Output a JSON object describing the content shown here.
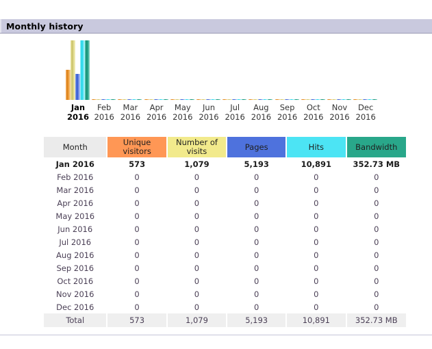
{
  "section": {
    "title": "Monthly history"
  },
  "chart_data": {
    "type": "bar",
    "title": "Monthly history",
    "xlabel": "",
    "ylabel": "",
    "grid": false,
    "legend": "none",
    "categories": [
      "Jan 2016",
      "Feb 2016",
      "Mar 2016",
      "Apr 2016",
      "May 2016",
      "Jun 2016",
      "Jul 2016",
      "Aug 2016",
      "Sep 2016",
      "Oct 2016",
      "Nov 2016",
      "Dec 2016"
    ],
    "category_lines": [
      {
        "mon": "Jan",
        "yr": "2016"
      },
      {
        "mon": "Feb",
        "yr": "2016"
      },
      {
        "mon": "Mar",
        "yr": "2016"
      },
      {
        "mon": "Apr",
        "yr": "2016"
      },
      {
        "mon": "May",
        "yr": "2016"
      },
      {
        "mon": "Jun",
        "yr": "2016"
      },
      {
        "mon": "Jul",
        "yr": "2016"
      },
      {
        "mon": "Aug",
        "yr": "2016"
      },
      {
        "mon": "Sep",
        "yr": "2016"
      },
      {
        "mon": "Oct",
        "yr": "2016"
      },
      {
        "mon": "Nov",
        "yr": "2016"
      },
      {
        "mon": "Dec",
        "yr": "2016"
      }
    ],
    "highlighted_category": "Jan 2016",
    "series": [
      {
        "name": "Unique visitors",
        "key": "unique",
        "color": "#ff9755",
        "values": [
          573,
          0,
          0,
          0,
          0,
          0,
          0,
          0,
          0,
          0,
          0,
          0
        ]
      },
      {
        "name": "Number of visits",
        "key": "visits",
        "color": "#f2ea8c",
        "values": [
          1079,
          0,
          0,
          0,
          0,
          0,
          0,
          0,
          0,
          0,
          0,
          0
        ]
      },
      {
        "name": "Pages",
        "key": "pages",
        "color": "#4e72dd",
        "values": [
          5193,
          0,
          0,
          0,
          0,
          0,
          0,
          0,
          0,
          0,
          0,
          0
        ]
      },
      {
        "name": "Hits",
        "key": "hits",
        "color": "#4ce4f4",
        "values": [
          10891,
          0,
          0,
          0,
          0,
          0,
          0,
          0,
          0,
          0,
          0,
          0
        ]
      },
      {
        "name": "Bandwidth",
        "key": "bw",
        "color": "#29a78a",
        "values": [
          352.73,
          0,
          0,
          0,
          0,
          0,
          0,
          0,
          0,
          0,
          0,
          0
        ],
        "unit": "MB"
      }
    ],
    "bar_pixel_heights": {
      "unique": [
        44,
        1,
        1,
        1,
        1,
        1,
        1,
        1,
        1,
        1,
        1,
        1
      ],
      "visits": [
        87,
        1,
        1,
        1,
        1,
        1,
        1,
        1,
        1,
        1,
        1,
        1
      ],
      "pages": [
        38,
        1,
        1,
        1,
        1,
        1,
        1,
        1,
        1,
        1,
        1,
        1
      ],
      "hits": [
        87,
        1,
        1,
        1,
        1,
        1,
        1,
        1,
        1,
        1,
        1,
        1
      ],
      "bw": [
        87,
        1,
        1,
        1,
        1,
        1,
        1,
        1,
        1,
        1,
        1,
        1
      ]
    }
  },
  "table": {
    "headers": [
      {
        "label": "Month",
        "key": "month",
        "color": "#ebebeb"
      },
      {
        "label": "Unique visitors",
        "key": "unique",
        "color": "#ff9755"
      },
      {
        "label": "Number of visits",
        "key": "visits",
        "color": "#f2ea8c"
      },
      {
        "label": "Pages",
        "key": "pages",
        "color": "#4e72dd"
      },
      {
        "label": "Hits",
        "key": "hits",
        "color": "#4ce4f4"
      },
      {
        "label": "Bandwidth",
        "key": "bw",
        "color": "#29a78a"
      }
    ],
    "header_lines": {
      "month": [
        "Month"
      ],
      "unique": [
        "Unique",
        "visitors"
      ],
      "visits": [
        "Number of",
        "visits"
      ],
      "pages": [
        "Pages"
      ],
      "hits": [
        "Hits"
      ],
      "bw": [
        "Bandwidth"
      ]
    },
    "rows": [
      {
        "month": "Jan 2016",
        "unique": "573",
        "visits": "1,079",
        "pages": "5,193",
        "hits": "10,891",
        "bw": "352.73 MB",
        "current": true
      },
      {
        "month": "Feb 2016",
        "unique": "0",
        "visits": "0",
        "pages": "0",
        "hits": "0",
        "bw": "0",
        "current": false
      },
      {
        "month": "Mar 2016",
        "unique": "0",
        "visits": "0",
        "pages": "0",
        "hits": "0",
        "bw": "0",
        "current": false
      },
      {
        "month": "Apr 2016",
        "unique": "0",
        "visits": "0",
        "pages": "0",
        "hits": "0",
        "bw": "0",
        "current": false
      },
      {
        "month": "May 2016",
        "unique": "0",
        "visits": "0",
        "pages": "0",
        "hits": "0",
        "bw": "0",
        "current": false
      },
      {
        "month": "Jun 2016",
        "unique": "0",
        "visits": "0",
        "pages": "0",
        "hits": "0",
        "bw": "0",
        "current": false
      },
      {
        "month": "Jul 2016",
        "unique": "0",
        "visits": "0",
        "pages": "0",
        "hits": "0",
        "bw": "0",
        "current": false
      },
      {
        "month": "Aug 2016",
        "unique": "0",
        "visits": "0",
        "pages": "0",
        "hits": "0",
        "bw": "0",
        "current": false
      },
      {
        "month": "Sep 2016",
        "unique": "0",
        "visits": "0",
        "pages": "0",
        "hits": "0",
        "bw": "0",
        "current": false
      },
      {
        "month": "Oct 2016",
        "unique": "0",
        "visits": "0",
        "pages": "0",
        "hits": "0",
        "bw": "0",
        "current": false
      },
      {
        "month": "Nov 2016",
        "unique": "0",
        "visits": "0",
        "pages": "0",
        "hits": "0",
        "bw": "0",
        "current": false
      },
      {
        "month": "Dec 2016",
        "unique": "0",
        "visits": "0",
        "pages": "0",
        "hits": "0",
        "bw": "0",
        "current": false
      }
    ],
    "total": {
      "month": "Total",
      "unique": "573",
      "visits": "1,079",
      "pages": "5,193",
      "hits": "10,891",
      "bw": "352.73 MB"
    }
  }
}
